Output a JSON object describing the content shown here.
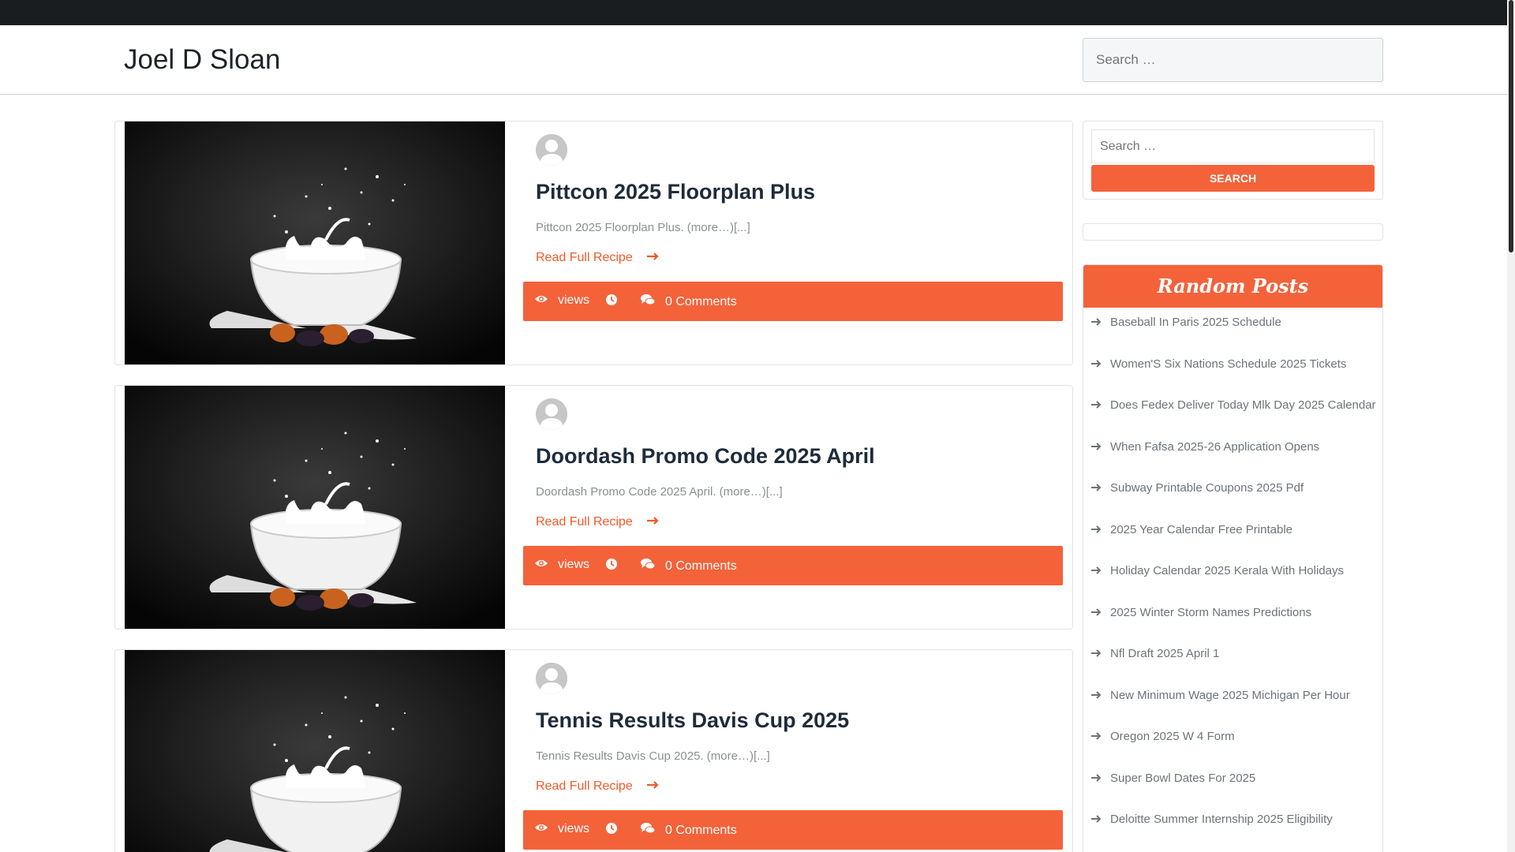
{
  "site": {
    "title": "Joel D Sloan"
  },
  "header_search": {
    "placeholder": "Search …"
  },
  "colors": {
    "accent": "#f4623a",
    "topbar": "#1a1d1f",
    "title": "#1e2b3a"
  },
  "posts": [
    {
      "title": "Pittcon 2025 Floorplan Plus",
      "excerpt": "Pittcon 2025 Floorplan Plus. (more…)[...]",
      "read_more": "Read Full Recipe",
      "views_label": "views",
      "comments": "0 Comments"
    },
    {
      "title": "Doordash Promo Code 2025 April",
      "excerpt": "Doordash Promo Code 2025 April. (more…)[...]",
      "read_more": "Read Full Recipe",
      "views_label": "views",
      "comments": "0 Comments"
    },
    {
      "title": "Tennis Results Davis Cup 2025",
      "excerpt": "Tennis Results Davis Cup 2025. (more…)[...]",
      "read_more": "Read Full Recipe",
      "views_label": "views",
      "comments": "0 Comments"
    }
  ],
  "sidebar": {
    "search": {
      "placeholder": "Search …",
      "button": "SEARCH"
    },
    "random_posts": {
      "title": "Random Posts",
      "items": [
        "Baseball In Paris 2025 Schedule",
        "Women'S Six Nations Schedule 2025 Tickets",
        "Does Fedex Deliver Today Mlk Day 2025 Calendar",
        "When Fafsa 2025-26 Application Opens",
        "Subway Printable Coupons 2025 Pdf",
        "2025 Year Calendar Free Printable",
        "Holiday Calendar 2025 Kerala With Holidays",
        "2025 Winter Storm Names Predictions",
        "Nfl Draft 2025 April 1",
        "New Minimum Wage 2025 Michigan Per Hour",
        "Oregon 2025 W 4 Form",
        "Super Bowl Dates For 2025",
        "Deloitte Summer Internship 2025 Eligibility"
      ]
    }
  }
}
